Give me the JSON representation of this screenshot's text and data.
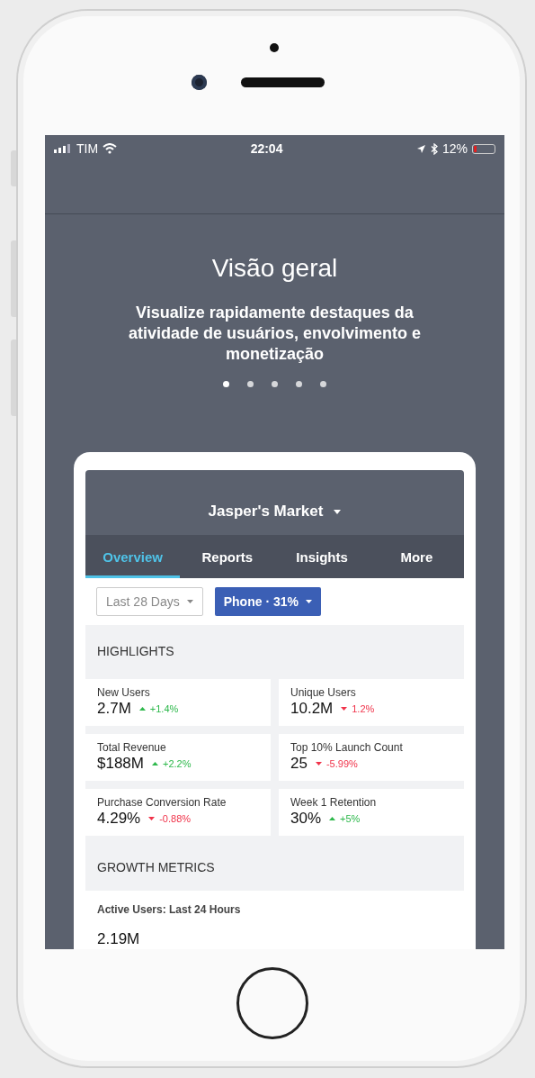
{
  "status_bar": {
    "carrier": "TIM",
    "time": "22:04",
    "battery": {
      "text": "12%",
      "level": 0.12
    }
  },
  "onboarding": {
    "title": "Visão geral",
    "subtitle": "Visualize rapidamente destaques da atividade de usuários, envolvimento e monetização",
    "pages": [
      {
        "selected": true
      },
      {
        "selected": false
      },
      {
        "selected": false
      },
      {
        "selected": false
      },
      {
        "selected": false
      }
    ]
  },
  "dashboard": {
    "app_title": "Jasper's Market",
    "tabs": [
      {
        "label": "Overview",
        "selected": true
      },
      {
        "label": "Reports",
        "selected": false
      },
      {
        "label": "Insights",
        "selected": false
      },
      {
        "label": "More",
        "selected": false
      }
    ],
    "filters": [
      {
        "label": "Last 28 Days",
        "kind": "outline"
      },
      {
        "label": "Phone · 31%",
        "kind": "filled"
      }
    ],
    "highlights_title": "HIGHLIGHTS",
    "metrics": [
      {
        "label": "New Users",
        "value": "2.7M",
        "change": "+1.4%",
        "kind": "up"
      },
      {
        "label": "Unique Users",
        "value": "10.2M",
        "change": "1.2%",
        "kind": "down"
      },
      {
        "label": "Total Revenue",
        "value": "$188M",
        "change": "+2.2%",
        "kind": "up"
      },
      {
        "label": "Top 10% Launch Count",
        "value": "25",
        "change": "-5.99%",
        "kind": "down"
      },
      {
        "label": "Purchase Conversion Rate",
        "value": "4.29%",
        "change": "-0.88%",
        "kind": "down"
      },
      {
        "label": "Week 1 Retention",
        "value": "30%",
        "change": "+5%",
        "kind": "up"
      }
    ],
    "growth_title": "GROWTH METRICS",
    "growth_subtitle": "Active Users: Last 24 Hours",
    "growth_value": "2.19M"
  }
}
